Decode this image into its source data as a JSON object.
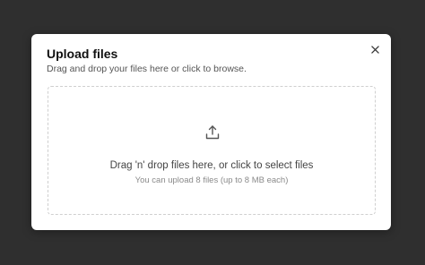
{
  "modal": {
    "title": "Upload files",
    "description": "Drag and drop your files here or click to browse.",
    "close_icon": "close-icon"
  },
  "dropzone": {
    "icon": "upload-icon",
    "title": "Drag 'n' drop files here, or click to select files",
    "subtitle": "You can upload 8 files (up to 8 MB each)"
  },
  "colors": {
    "backdrop": "#2f2f2f",
    "modal_bg": "#ffffff",
    "dropzone_border": "#cfcfcf"
  }
}
